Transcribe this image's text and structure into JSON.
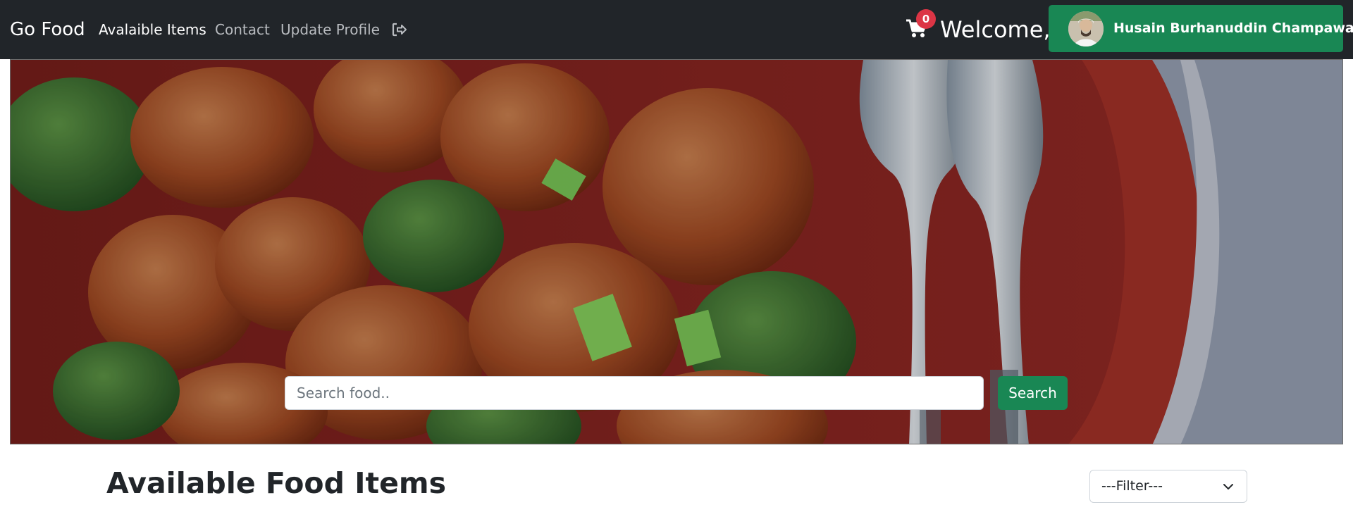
{
  "navbar": {
    "brand": "Go Food",
    "links": [
      {
        "label": "Avalaible Items",
        "active": true
      },
      {
        "label": "Contact",
        "active": false
      },
      {
        "label": "Update Profile",
        "active": false
      }
    ],
    "logout_icon": "sign-out-icon",
    "cart": {
      "icon": "shopping-cart-icon",
      "count": "0"
    },
    "welcome": "Welcome,",
    "user": {
      "name": "Husain Burhanuddin Champawala"
    }
  },
  "hero": {
    "search_placeholder": "Search food..",
    "search_value": "",
    "search_button": "Search"
  },
  "main": {
    "title": "Available Food Items",
    "filter": {
      "selected": "---Filter---"
    }
  },
  "colors": {
    "navbar": "#212529",
    "accent_green": "#198754",
    "badge_red": "#dc3545"
  }
}
